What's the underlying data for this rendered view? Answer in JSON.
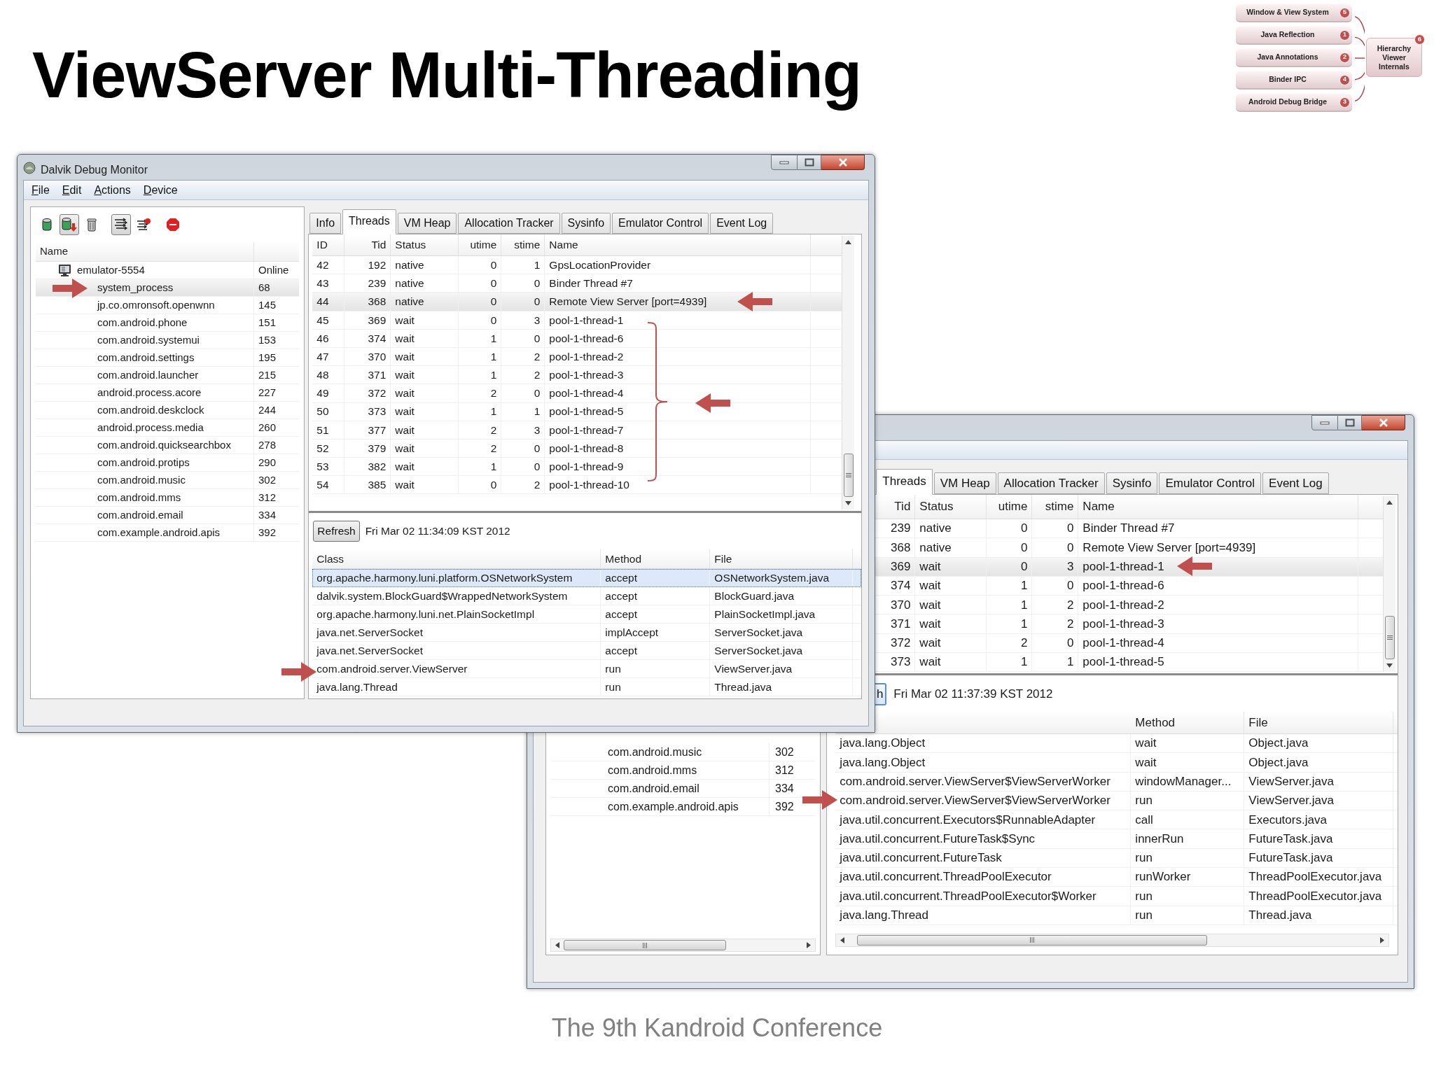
{
  "slide": {
    "title": "ViewServer Multi-Threading",
    "footer": "The 9th Kandroid Conference"
  },
  "topic_map": {
    "topics": [
      {
        "label": "Window & View System",
        "badge": "5"
      },
      {
        "label": "Java Reflection",
        "badge": "1"
      },
      {
        "label": "Java Annotations",
        "badge": "2"
      },
      {
        "label": "Binder IPC",
        "badge": "4"
      },
      {
        "label": "Android Debug Bridge",
        "badge": "3"
      }
    ],
    "center": {
      "label": "Hierarchy Viewer Internals",
      "badge": "6"
    }
  },
  "ddms_window": {
    "title": "Dalvik Debug Monitor",
    "menu": [
      "File",
      "Edit",
      "Actions",
      "Device"
    ],
    "toolbar": [
      {
        "kind": "heap",
        "pressed": false
      },
      {
        "kind": "heap-dump",
        "pressed": true
      },
      {
        "kind": "gc",
        "pressed": false
      },
      {
        "kind": "threads",
        "pressed": true
      },
      {
        "kind": "profile",
        "pressed": false
      },
      {
        "kind": "stop",
        "pressed": false
      }
    ],
    "devices": {
      "columns": [
        "Name"
      ],
      "device": {
        "name": "emulator-5554",
        "status": "Online"
      },
      "processes": [
        {
          "name": "system_process",
          "pid": "68",
          "selected": true
        },
        {
          "name": "jp.co.omronsoft.openwnn",
          "pid": "145",
          "selected": false
        },
        {
          "name": "com.android.phone",
          "pid": "151",
          "selected": false
        },
        {
          "name": "com.android.systemui",
          "pid": "153",
          "selected": false
        },
        {
          "name": "com.android.settings",
          "pid": "195",
          "selected": false
        },
        {
          "name": "com.android.launcher",
          "pid": "215",
          "selected": false
        },
        {
          "name": "android.process.acore",
          "pid": "227",
          "selected": false
        },
        {
          "name": "com.android.deskclock",
          "pid": "244",
          "selected": false
        },
        {
          "name": "android.process.media",
          "pid": "260",
          "selected": false
        },
        {
          "name": "com.android.quicksearchbox",
          "pid": "278",
          "selected": false
        },
        {
          "name": "com.android.protips",
          "pid": "290",
          "selected": false
        },
        {
          "name": "com.android.music",
          "pid": "302",
          "selected": false
        },
        {
          "name": "com.android.mms",
          "pid": "312",
          "selected": false
        },
        {
          "name": "com.android.email",
          "pid": "334",
          "selected": false
        },
        {
          "name": "com.example.android.apis",
          "pid": "392",
          "selected": false
        }
      ]
    },
    "tabs": [
      {
        "label": "Info",
        "selected": false
      },
      {
        "label": "Threads",
        "selected": true
      },
      {
        "label": "VM Heap",
        "selected": false
      },
      {
        "label": "Allocation Tracker",
        "selected": false
      },
      {
        "label": "Sysinfo",
        "selected": false
      },
      {
        "label": "Emulator Control",
        "selected": false
      },
      {
        "label": "Event Log",
        "selected": false
      }
    ],
    "threads": {
      "columns": [
        "ID",
        "Tid",
        "Status",
        "utime",
        "stime",
        "Name"
      ],
      "rows": [
        {
          "cells": [
            "42",
            "192",
            "native",
            "0",
            "1",
            "GpsLocationProvider"
          ],
          "selected": false
        },
        {
          "cells": [
            "43",
            "239",
            "native",
            "0",
            "0",
            "Binder Thread #7"
          ],
          "selected": false
        },
        {
          "cells": [
            "44",
            "368",
            "native",
            "0",
            "0",
            "Remote View Server [port=4939]"
          ],
          "selected": true
        },
        {
          "cells": [
            "45",
            "369",
            "wait",
            "0",
            "3",
            "pool-1-thread-1"
          ],
          "selected": false
        },
        {
          "cells": [
            "46",
            "374",
            "wait",
            "1",
            "0",
            "pool-1-thread-6"
          ],
          "selected": false
        },
        {
          "cells": [
            "47",
            "370",
            "wait",
            "1",
            "2",
            "pool-1-thread-2"
          ],
          "selected": false
        },
        {
          "cells": [
            "48",
            "371",
            "wait",
            "1",
            "2",
            "pool-1-thread-3"
          ],
          "selected": false
        },
        {
          "cells": [
            "49",
            "372",
            "wait",
            "2",
            "0",
            "pool-1-thread-4"
          ],
          "selected": false
        },
        {
          "cells": [
            "50",
            "373",
            "wait",
            "1",
            "1",
            "pool-1-thread-5"
          ],
          "selected": false
        },
        {
          "cells": [
            "51",
            "377",
            "wait",
            "2",
            "3",
            "pool-1-thread-7"
          ],
          "selected": false
        },
        {
          "cells": [
            "52",
            "379",
            "wait",
            "2",
            "0",
            "pool-1-thread-8"
          ],
          "selected": false
        },
        {
          "cells": [
            "53",
            "382",
            "wait",
            "1",
            "0",
            "pool-1-thread-9"
          ],
          "selected": false
        },
        {
          "cells": [
            "54",
            "385",
            "wait",
            "0",
            "2",
            "pool-1-thread-10"
          ],
          "selected": false
        }
      ]
    },
    "refresh": "Refresh",
    "timestamp": "Fri Mar 02 11:34:09 KST 2012",
    "stack": {
      "columns": [
        "Class",
        "Method",
        "File"
      ],
      "rows": [
        {
          "cells": [
            "org.apache.harmony.luni.platform.OSNetworkSystem",
            "accept",
            "OSNetworkSystem.java"
          ],
          "selected": true
        },
        {
          "cells": [
            "dalvik.system.BlockGuard$WrappedNetworkSystem",
            "accept",
            "BlockGuard.java"
          ],
          "selected": false
        },
        {
          "cells": [
            "org.apache.harmony.luni.net.PlainSocketImpl",
            "accept",
            "PlainSocketImpl.java"
          ],
          "selected": false
        },
        {
          "cells": [
            "java.net.ServerSocket",
            "implAccept",
            "ServerSocket.java"
          ],
          "selected": false
        },
        {
          "cells": [
            "java.net.ServerSocket",
            "accept",
            "ServerSocket.java"
          ],
          "selected": false
        },
        {
          "cells": [
            "com.android.server.ViewServer",
            "run",
            "ViewServer.java"
          ],
          "selected": false
        },
        {
          "cells": [
            "java.lang.Thread",
            "run",
            "Thread.java"
          ],
          "selected": false
        }
      ]
    }
  },
  "second_window": {
    "processes": [
      {
        "name": "com.android.music",
        "pid": "302"
      },
      {
        "name": "com.android.mms",
        "pid": "312"
      },
      {
        "name": "com.android.email",
        "pid": "334"
      },
      {
        "name": "com.example.android.apis",
        "pid": "392"
      }
    ],
    "tabs": [
      {
        "label": "Threads",
        "selected": true
      },
      {
        "label": "VM Heap",
        "selected": false
      },
      {
        "label": "Allocation Tracker",
        "selected": false
      },
      {
        "label": "Sysinfo",
        "selected": false
      },
      {
        "label": "Emulator Control",
        "selected": false
      },
      {
        "label": "Event Log",
        "selected": false
      }
    ],
    "threads": {
      "columns": [
        "Tid",
        "Status",
        "utime",
        "stime",
        "Name"
      ],
      "rows": [
        {
          "cells": [
            "239",
            "native",
            "0",
            "0",
            "Binder Thread #7"
          ],
          "selected": false
        },
        {
          "cells": [
            "368",
            "native",
            "0",
            "0",
            "Remote View Server [port=4939]"
          ],
          "selected": false
        },
        {
          "cells": [
            "369",
            "wait",
            "0",
            "3",
            "pool-1-thread-1"
          ],
          "selected": true
        },
        {
          "cells": [
            "374",
            "wait",
            "1",
            "0",
            "pool-1-thread-6"
          ],
          "selected": false
        },
        {
          "cells": [
            "370",
            "wait",
            "1",
            "2",
            "pool-1-thread-2"
          ],
          "selected": false
        },
        {
          "cells": [
            "371",
            "wait",
            "1",
            "2",
            "pool-1-thread-3"
          ],
          "selected": false
        },
        {
          "cells": [
            "372",
            "wait",
            "2",
            "0",
            "pool-1-thread-4"
          ],
          "selected": false
        },
        {
          "cells": [
            "373",
            "wait",
            "1",
            "1",
            "pool-1-thread-5"
          ],
          "selected": false
        }
      ]
    },
    "refresh": "h",
    "timestamp": "Fri Mar 02 11:37:39 KST 2012",
    "stack": {
      "columns": [
        "",
        "Method",
        "File"
      ],
      "rows": [
        {
          "cells": [
            "java.lang.Object",
            "wait",
            "Object.java"
          ]
        },
        {
          "cells": [
            "java.lang.Object",
            "wait",
            "Object.java"
          ]
        },
        {
          "cells": [
            "com.android.server.ViewServer$ViewServerWorker",
            "windowManager...",
            "ViewServer.java"
          ]
        },
        {
          "cells": [
            "com.android.server.ViewServer$ViewServerWorker",
            "run",
            "ViewServer.java"
          ]
        },
        {
          "cells": [
            "java.util.concurrent.Executors$RunnableAdapter",
            "call",
            "Executors.java"
          ]
        },
        {
          "cells": [
            "java.util.concurrent.FutureTask$Sync",
            "innerRun",
            "FutureTask.java"
          ]
        },
        {
          "cells": [
            "java.util.concurrent.FutureTask",
            "run",
            "FutureTask.java"
          ]
        },
        {
          "cells": [
            "java.util.concurrent.ThreadPoolExecutor",
            "runWorker",
            "ThreadPoolExecutor.java"
          ]
        },
        {
          "cells": [
            "java.util.concurrent.ThreadPoolExecutor$Worker",
            "run",
            "ThreadPoolExecutor.java"
          ]
        },
        {
          "cells": [
            "java.lang.Thread",
            "run",
            "Thread.java"
          ]
        }
      ]
    }
  }
}
